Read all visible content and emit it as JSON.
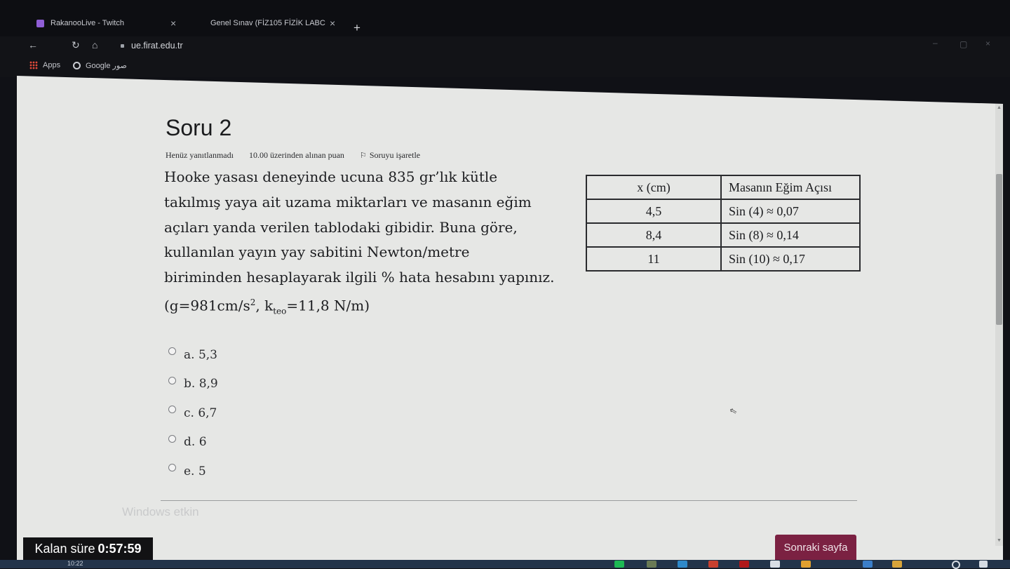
{
  "browser": {
    "tabs": [
      {
        "label": "RakanooLive - Twitch",
        "icon": "twitch-icon"
      },
      {
        "label": "Genel Sınav (FİZ105 FİZİK LABC",
        "icon": "page-icon"
      }
    ],
    "new_tab": "+",
    "url": "ue.firat.edu.tr",
    "bookmarks": [
      {
        "label": "Apps",
        "icon": "apps-grid-icon"
      },
      {
        "label": "Google صور",
        "icon": "google-icon"
      }
    ]
  },
  "question": {
    "title": "Soru 2",
    "status": "Henüz yanıtlanmadı",
    "points": "10.00 üzerinden alınan puan",
    "flag_label": "Soruyu işaretle",
    "text_lines": [
      "Hooke yasası deneyinde ucuna 835 gr’lık kütle",
      "takılmış yaya ait uzama miktarları ve masanın eğim",
      "açıları yanda verilen tablodaki gibidir. Buna göre,",
      "kullanılan yayın yay sabitini Newton/metre",
      "biriminden hesaplayarak ilgili % hata hesabını yapınız."
    ],
    "formula": {
      "g_part": "(g=981cm/s",
      "g_exp": "2",
      "k_part": ", k",
      "k_sub": "teo",
      "k_value": "=11,8 N/m)"
    },
    "table": {
      "headers": [
        "x (cm)",
        "Masanın Eğim Açısı"
      ],
      "rows": [
        [
          "4,5",
          "Sin (4) ≈ 0,07"
        ],
        [
          "8,4",
          "Sin (8) ≈ 0,14"
        ],
        [
          "11",
          "Sin (10) ≈ 0,17"
        ]
      ]
    },
    "options": [
      "a. 5,3",
      "b. 8,9",
      "c. 6,7",
      "d. 6",
      "e. 5"
    ]
  },
  "footer": {
    "timer_label": "Kalan süre",
    "timer_value": "0:57:59",
    "next_button": "Sonraki sayfa",
    "watermark": "Windows etkin",
    "clock": "10:22"
  }
}
